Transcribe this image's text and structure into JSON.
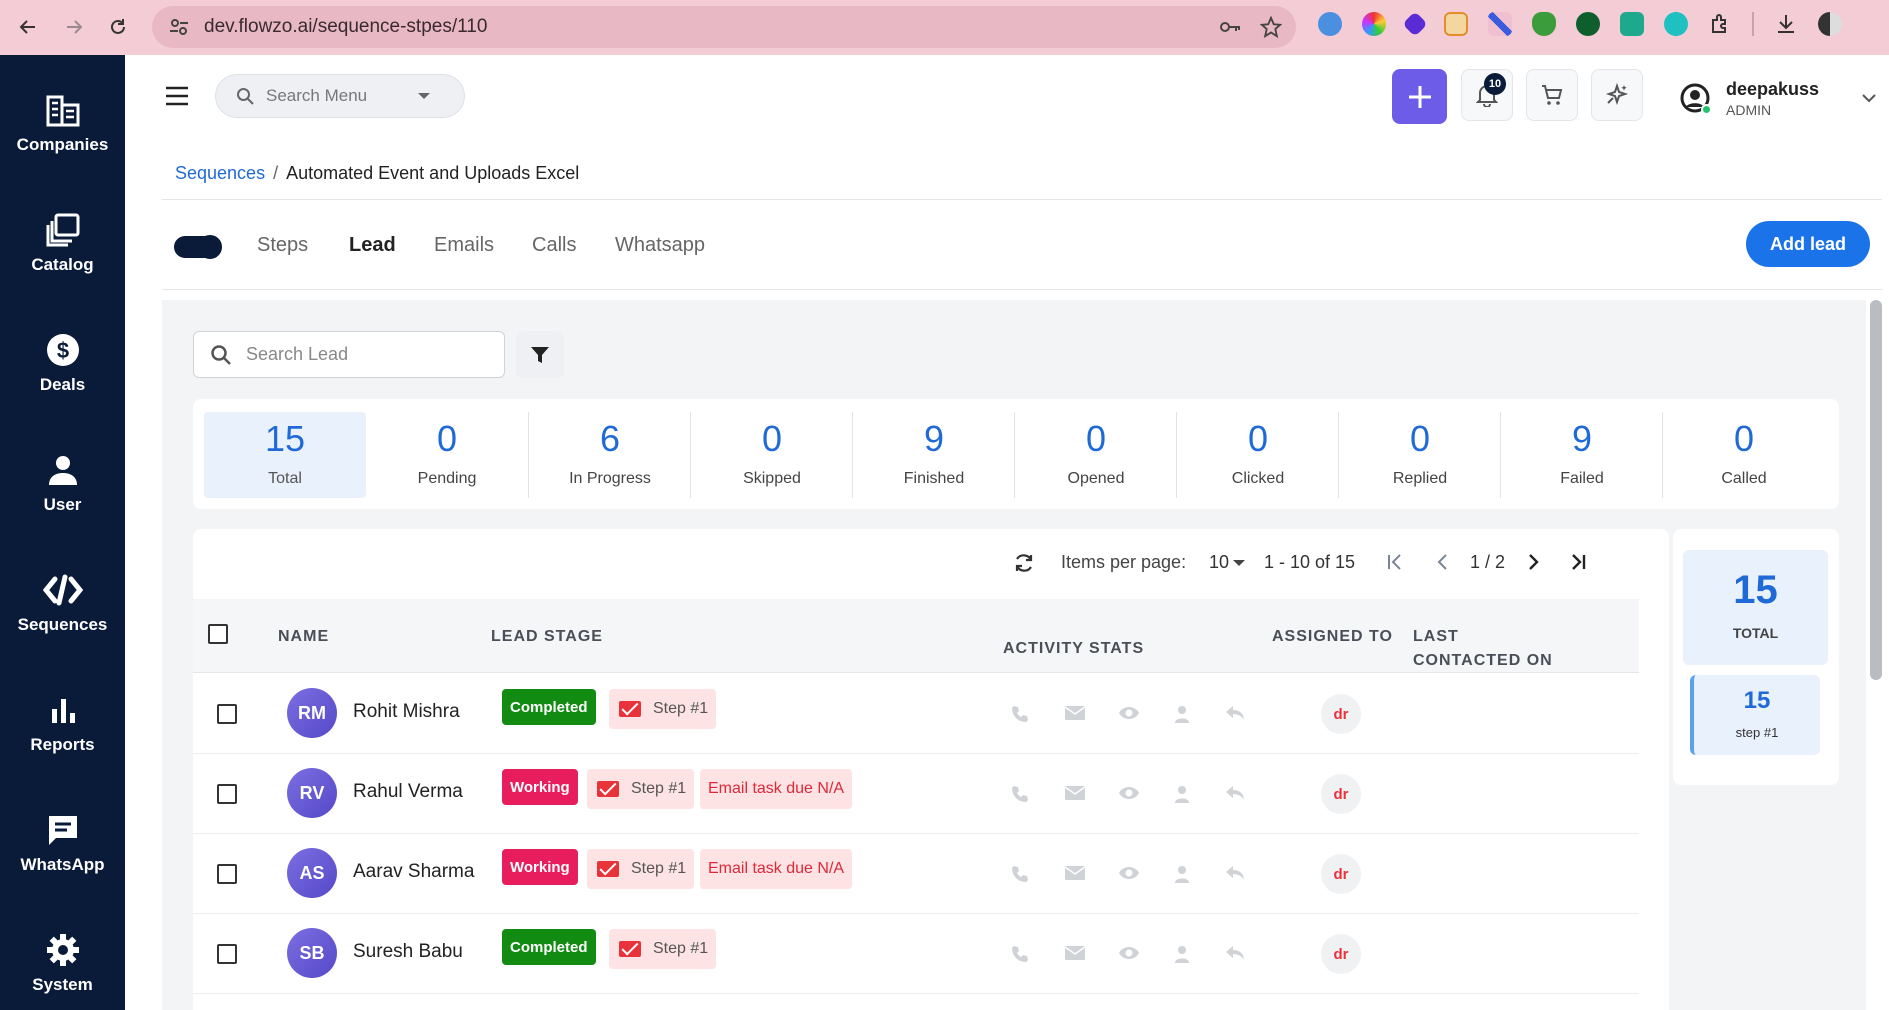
{
  "browser": {
    "url": "dev.flowzo.ai/sequence-stpes/110"
  },
  "sidebar": {
    "items": [
      {
        "label": "Companies",
        "icon": "companies-icon"
      },
      {
        "label": "Catalog",
        "icon": "catalog-icon"
      },
      {
        "label": "Deals",
        "icon": "dollar-icon"
      },
      {
        "label": "User",
        "icon": "user-icon"
      },
      {
        "label": "Sequences",
        "icon": "sequences-icon"
      },
      {
        "label": "Reports",
        "icon": "reports-icon"
      },
      {
        "label": "WhatsApp",
        "icon": "chat-icon"
      },
      {
        "label": "System",
        "icon": "gear-icon"
      }
    ]
  },
  "header": {
    "search_placeholder": "Search Menu",
    "notification_count": "10",
    "user_name": "deepakuss",
    "user_role": "ADMIN"
  },
  "breadcrumb": {
    "parent": "Sequences",
    "separator": "/",
    "current": "Automated Event and Uploads Excel"
  },
  "tabs": {
    "items": [
      "Steps",
      "Lead",
      "Emails",
      "Calls",
      "Whatsapp"
    ],
    "active": "Lead",
    "add_lead_label": "Add lead"
  },
  "lead_search": {
    "placeholder": "Search Lead"
  },
  "stats": [
    {
      "value": "15",
      "label": "Total",
      "active": true
    },
    {
      "value": "0",
      "label": "Pending"
    },
    {
      "value": "6",
      "label": "In Progress"
    },
    {
      "value": "0",
      "label": "Skipped"
    },
    {
      "value": "9",
      "label": "Finished"
    },
    {
      "value": "0",
      "label": "Opened"
    },
    {
      "value": "0",
      "label": "Clicked"
    },
    {
      "value": "0",
      "label": "Replied"
    },
    {
      "value": "9",
      "label": "Failed"
    },
    {
      "value": "0",
      "label": "Called"
    }
  ],
  "pager": {
    "items_per_page_label": "Items per page:",
    "items_per_page_value": "10",
    "range": "1 - 10 of 15",
    "page": "1 / 2"
  },
  "table": {
    "headers": {
      "name": "NAME",
      "lead_stage": "LEAD STAGE",
      "activity_stats": "ACTIVITY STATS",
      "assigned_to": "ASSIGNED TO",
      "last_contacted_line1": "LAST",
      "last_contacted_line2": "CONTACTED ON"
    },
    "rows": [
      {
        "initials": "RM",
        "name": "Rohit Mishra",
        "stage": "Completed",
        "step": "Step #1",
        "due": "",
        "assigned": "dr"
      },
      {
        "initials": "RV",
        "name": "Rahul Verma",
        "stage": "Working",
        "step": "Step #1",
        "due": "Email task due N/A",
        "assigned": "dr"
      },
      {
        "initials": "AS",
        "name": "Aarav Sharma",
        "stage": "Working",
        "step": "Step #1",
        "due": "Email task due N/A",
        "assigned": "dr"
      },
      {
        "initials": "SB",
        "name": "Suresh Babu",
        "stage": "Completed",
        "step": "Step #1",
        "due": "",
        "assigned": "dr"
      }
    ]
  },
  "summary": {
    "total_value": "15",
    "total_label": "TOTAL",
    "step_value": "15",
    "step_label": "step #1"
  }
}
